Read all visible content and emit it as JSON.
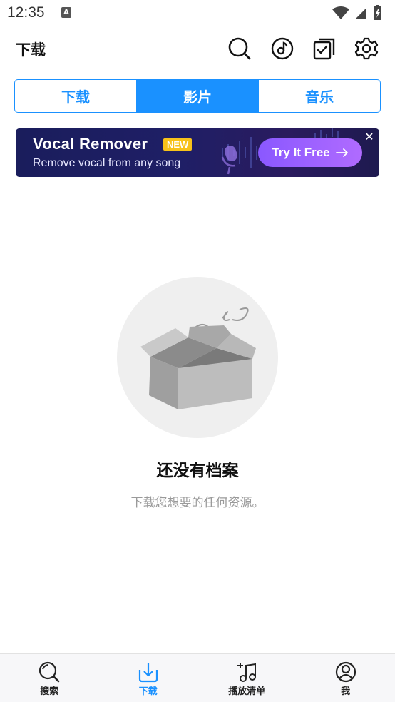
{
  "status": {
    "time": "12:35",
    "notification_letter": "A"
  },
  "header": {
    "title": "下载"
  },
  "tabs": [
    {
      "label": "下载",
      "active": false
    },
    {
      "label": "影片",
      "active": true
    },
    {
      "label": "音乐",
      "active": false
    }
  ],
  "banner": {
    "title": "Vocal Remover",
    "badge": "NEW",
    "subtitle": "Remove vocal from any song",
    "cta": "Try It Free",
    "close": "✕"
  },
  "empty_state": {
    "title": "还没有档案",
    "subtitle": "下载您想要的任何资源。"
  },
  "bottom_nav": [
    {
      "label": "搜索",
      "icon": "search-icon",
      "active": false
    },
    {
      "label": "下载",
      "icon": "download-icon",
      "active": true
    },
    {
      "label": "播放清单",
      "icon": "playlist-icon",
      "active": false
    },
    {
      "label": "我",
      "icon": "profile-icon",
      "active": false
    }
  ],
  "colors": {
    "accent": "#1a91ff",
    "banner_bg": "#1f1f66",
    "cta": "#9b62ff",
    "badge": "#f7c21a"
  }
}
